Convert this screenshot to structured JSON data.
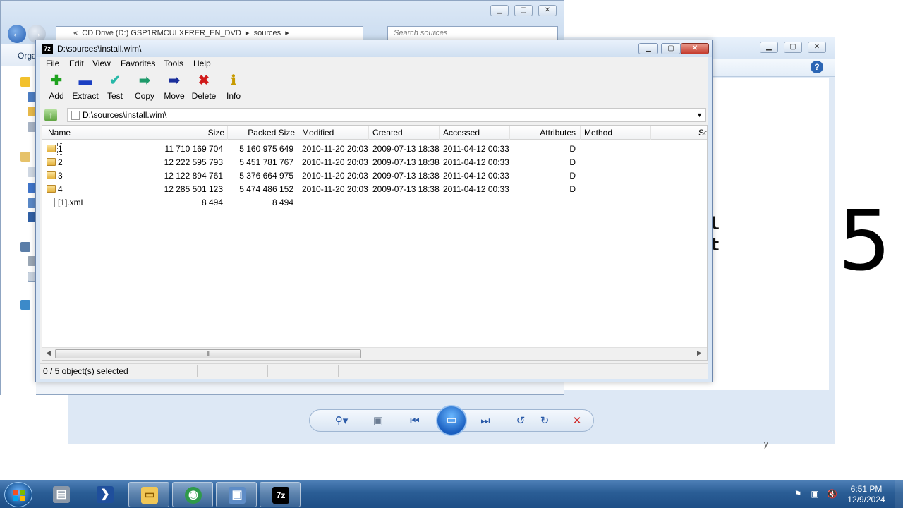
{
  "explorer": {
    "address_parts": [
      "«",
      "CD Drive (D:) GSP1RMCULXFRER_EN_DVD",
      "▸",
      "sources",
      "▸"
    ],
    "search_placeholder": "Search sources",
    "organize_label": "Orga"
  },
  "viewer": {
    "preview_char": "5",
    "fragments": [
      "l",
      "t"
    ],
    "stray_char": "y"
  },
  "zip": {
    "title": "D:\\sources\\install.wim\\",
    "logo_text": "7z",
    "menu": [
      "File",
      "Edit",
      "View",
      "Favorites",
      "Tools",
      "Help"
    ],
    "toolbar": [
      {
        "label": "Add",
        "icon": "plus-icon",
        "glyph": "✚",
        "color": "#1ea21e"
      },
      {
        "label": "Extract",
        "icon": "minus-icon",
        "glyph": "▬",
        "color": "#1b3fc2"
      },
      {
        "label": "Test",
        "icon": "check-icon",
        "glyph": "✔",
        "color": "#27b8a8"
      },
      {
        "label": "Copy",
        "icon": "copy-arrow-icon",
        "glyph": "➡",
        "color": "#1e9a6a"
      },
      {
        "label": "Move",
        "icon": "move-arrow-icon",
        "glyph": "➡",
        "color": "#1b2f9c"
      },
      {
        "label": "Delete",
        "icon": "delete-icon",
        "glyph": "✖",
        "color": "#d01a1a"
      },
      {
        "label": "Info",
        "icon": "info-icon",
        "glyph": "ℹ",
        "color": "#c79a00"
      }
    ],
    "path": "D:\\sources\\install.wim\\",
    "columns": [
      "Name",
      "Size",
      "Packed Size",
      "Modified",
      "Created",
      "Accessed",
      "Attributes",
      "Method",
      "So"
    ],
    "rows": [
      {
        "name": "1",
        "type": "folder",
        "size": "11 710 169 704",
        "packed": "5 160 975 649",
        "modified": "2010-11-20 20:03",
        "created": "2009-07-13 18:38",
        "accessed": "2011-04-12 00:33",
        "attributes": "D"
      },
      {
        "name": "2",
        "type": "folder",
        "size": "12 222 595 793",
        "packed": "5 451 781 767",
        "modified": "2010-11-20 20:03",
        "created": "2009-07-13 18:38",
        "accessed": "2011-04-12 00:33",
        "attributes": "D"
      },
      {
        "name": "3",
        "type": "folder",
        "size": "12 122 894 761",
        "packed": "5 376 664 975",
        "modified": "2010-11-20 20:03",
        "created": "2009-07-13 18:38",
        "accessed": "2011-04-12 00:33",
        "attributes": "D"
      },
      {
        "name": "4",
        "type": "folder",
        "size": "12 285 501 123",
        "packed": "5 474 486 152",
        "modified": "2010-11-20 20:03",
        "created": "2009-07-13 18:38",
        "accessed": "2011-04-12 00:33",
        "attributes": "D"
      },
      {
        "name": "[1].xml",
        "type": "file",
        "size": "8 494",
        "packed": "8 494",
        "modified": "",
        "created": "",
        "accessed": "",
        "attributes": ""
      }
    ],
    "status": "0 / 5 object(s) selected"
  },
  "taskbar": {
    "time": "6:51 PM",
    "date": "12/9/2024"
  }
}
